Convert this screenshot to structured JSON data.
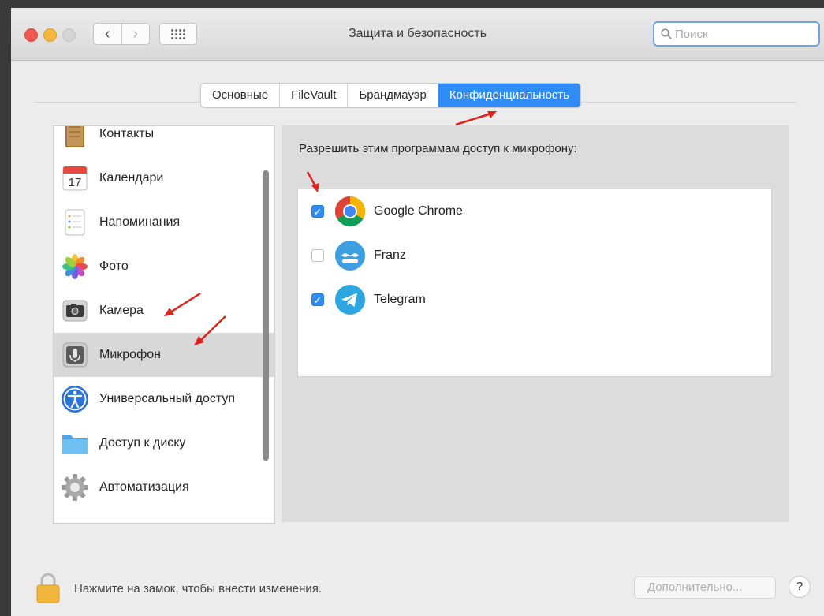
{
  "window": {
    "title": "Защита и безопасность"
  },
  "search": {
    "placeholder": "Поиск"
  },
  "tabs": [
    {
      "label": "Основные",
      "active": false
    },
    {
      "label": "FileVault",
      "active": false
    },
    {
      "label": "Брандмауэр",
      "active": false
    },
    {
      "label": "Конфиденциальность",
      "active": true
    }
  ],
  "sidebar": {
    "items": [
      {
        "label": "Контакты",
        "icon": "contacts-icon"
      },
      {
        "label": "Календари",
        "icon": "calendar-icon",
        "icon_text": "17"
      },
      {
        "label": "Напоминания",
        "icon": "reminders-icon"
      },
      {
        "label": "Фото",
        "icon": "photos-icon"
      },
      {
        "label": "Камера",
        "icon": "camera-icon"
      },
      {
        "label": "Микрофон",
        "icon": "microphone-icon",
        "selected": true
      },
      {
        "label": "Универсальный доступ",
        "icon": "accessibility-icon"
      },
      {
        "label": "Доступ к диску",
        "icon": "folder-icon"
      },
      {
        "label": "Автоматизация",
        "icon": "gear-icon"
      }
    ]
  },
  "panel": {
    "title": "Разрешить этим программам доступ к микрофону:",
    "apps": [
      {
        "name": "Google Chrome",
        "checked": true,
        "icon": "chrome-icon"
      },
      {
        "name": "Franz",
        "checked": false,
        "icon": "franz-icon"
      },
      {
        "name": "Telegram",
        "checked": true,
        "icon": "telegram-icon"
      }
    ]
  },
  "footer": {
    "lock_text": "Нажмите на замок, чтобы внести изменения.",
    "advanced_label": "Дополнительно...",
    "help_label": "?"
  },
  "colors": {
    "accent": "#2f8cf5",
    "annotation_arrow": "#e0231c"
  }
}
